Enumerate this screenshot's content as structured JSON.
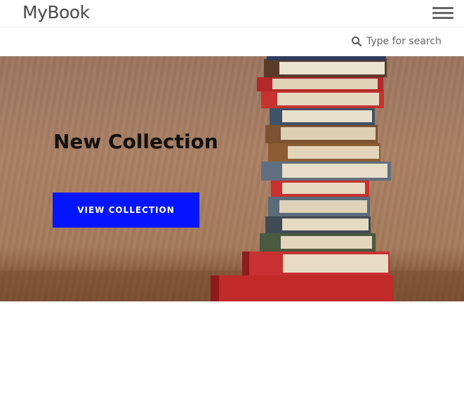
{
  "header": {
    "brand": "MyBook",
    "menu_icon": "hamburger-menu-icon"
  },
  "search": {
    "placeholder": "Type for search",
    "icon": "search-icon"
  },
  "hero": {
    "title": "New Collection",
    "cta_label": "VIEW COLLECTION",
    "cta_color": "#0316ff",
    "background_image": "stack-of-books-photo"
  }
}
